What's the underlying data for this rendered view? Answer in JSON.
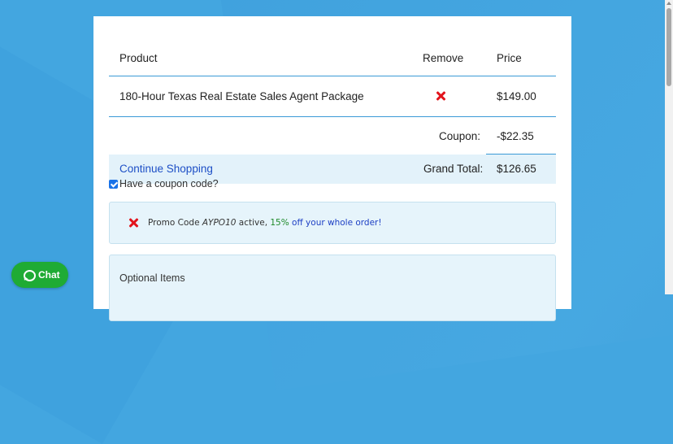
{
  "cart": {
    "headers": {
      "product": "Product",
      "remove": "Remove",
      "price": "Price"
    },
    "items": [
      {
        "name": "180-Hour Texas Real Estate Sales Agent Package",
        "price": "$149.00",
        "remove_icon": "close-icon"
      }
    ],
    "coupon_label": "Coupon:",
    "coupon_value": "-$22.35",
    "continue_shopping": "Continue Shopping",
    "grand_total_label": "Grand Total:",
    "grand_total_value": "$126.65"
  },
  "coupon_checkbox": {
    "label": "Have a coupon code?",
    "checked": true
  },
  "promo": {
    "prefix": "Promo Code ",
    "code": "AYPO10",
    "middle": " active, ",
    "percent": "15%",
    "suffix": " off your whole order!",
    "remove_icon": "close-icon"
  },
  "optional_items": {
    "title": "Optional Items"
  },
  "chat": {
    "label": "Chat",
    "icon": "chat-bubble-icon"
  },
  "colors": {
    "accent_line": "#3a9ad7",
    "remove_red": "#e2141c",
    "chat_green": "#1fab34",
    "link_blue": "#1d4fc6"
  }
}
